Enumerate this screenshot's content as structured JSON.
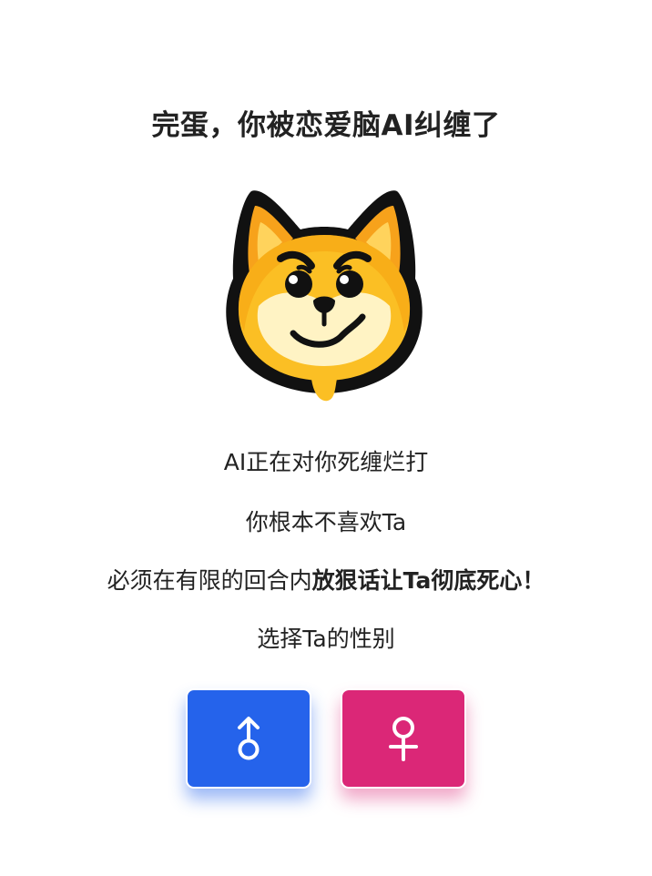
{
  "header": {
    "title": "完蛋，你被恋爱脑AI纠缠了"
  },
  "mascot": {
    "name": "shiba-inu-icon"
  },
  "intro": {
    "line1": "AI正在对你死缠烂打",
    "line2": "你根本不喜欢Ta",
    "line3_prefix": "必须在有限的回合内",
    "line3_bold": "放狠话让Ta彻底死心！",
    "line4": "选择Ta的性别"
  },
  "gender_buttons": {
    "male": {
      "icon": "male-symbol-icon",
      "color": "#2563eb"
    },
    "female": {
      "icon": "female-symbol-icon",
      "color": "#db2777"
    }
  }
}
